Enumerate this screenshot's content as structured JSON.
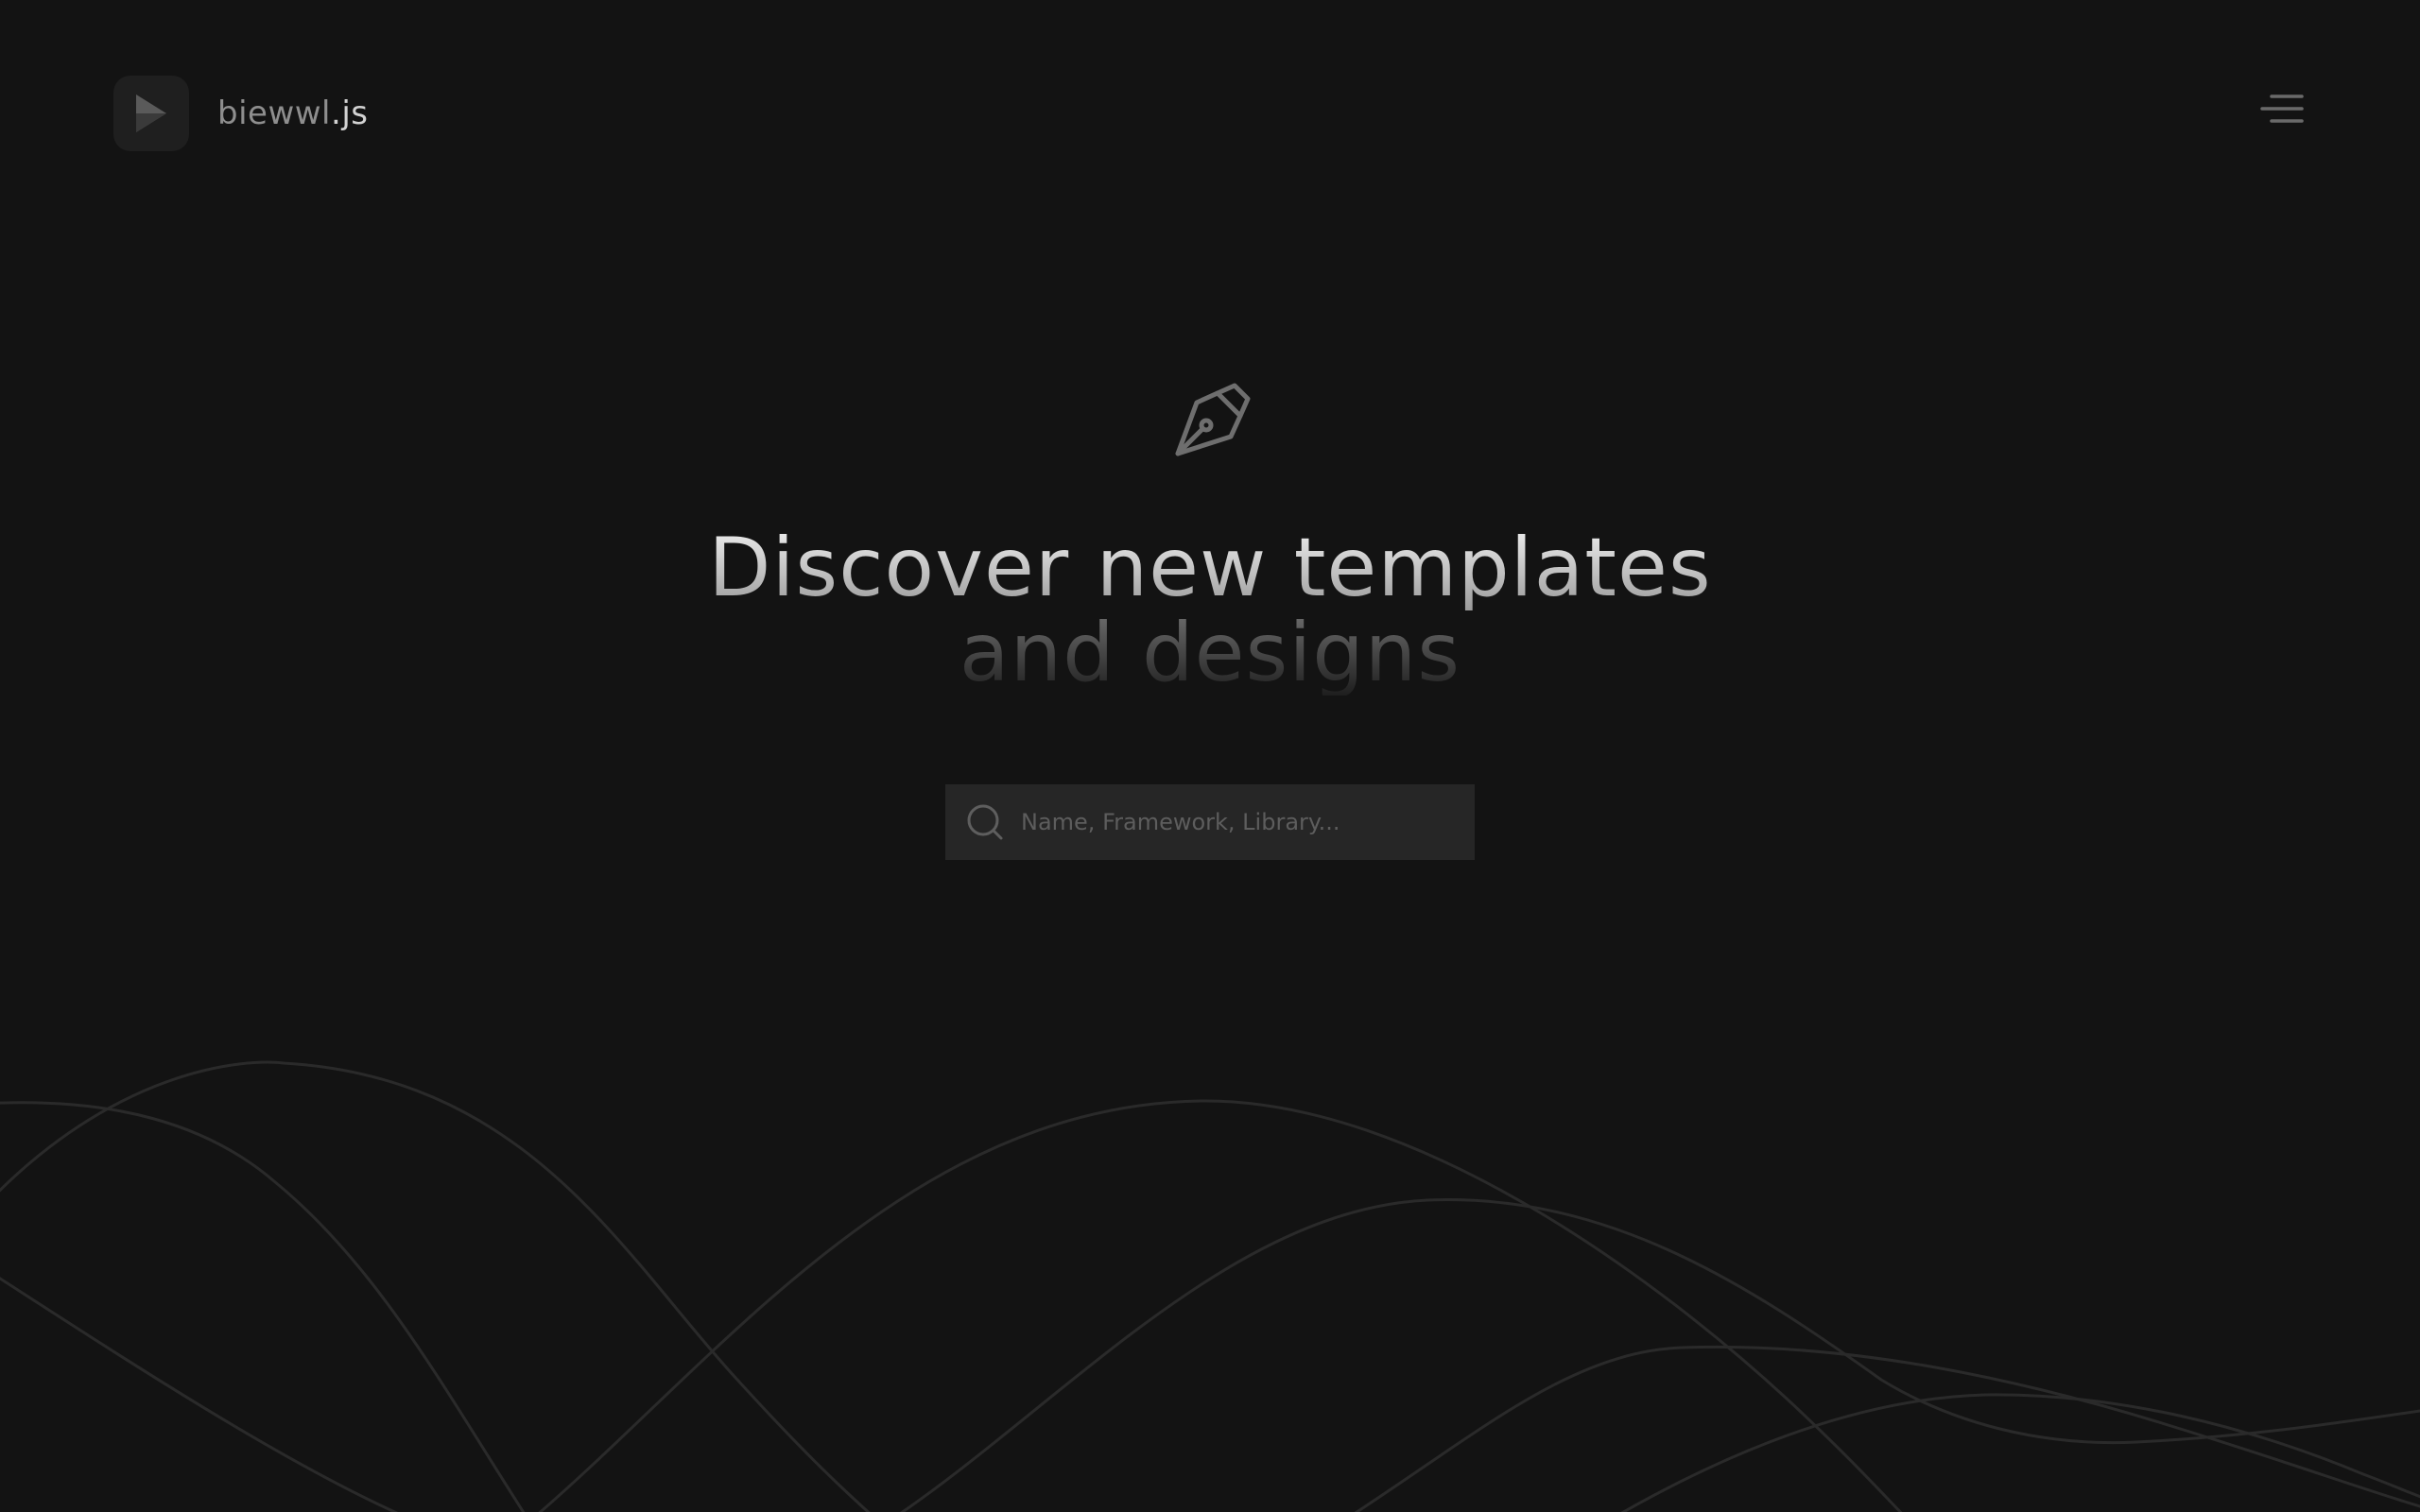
{
  "brand": {
    "name": "biewwl",
    "extension": ".js",
    "logo_icon": "play-icon"
  },
  "header": {
    "menu_icon": "menu-icon"
  },
  "hero": {
    "icon": "pen-nib-icon",
    "title_line1": "Discover new templates",
    "title_line2": "and designs"
  },
  "search": {
    "value": "",
    "placeholder": "Name, Framework, Library...",
    "icon": "search-icon"
  },
  "colors": {
    "background": "#131313",
    "logo_box": "#1f1f1f",
    "search_box": "#262626",
    "wave_lines": "#2a2a2a"
  }
}
